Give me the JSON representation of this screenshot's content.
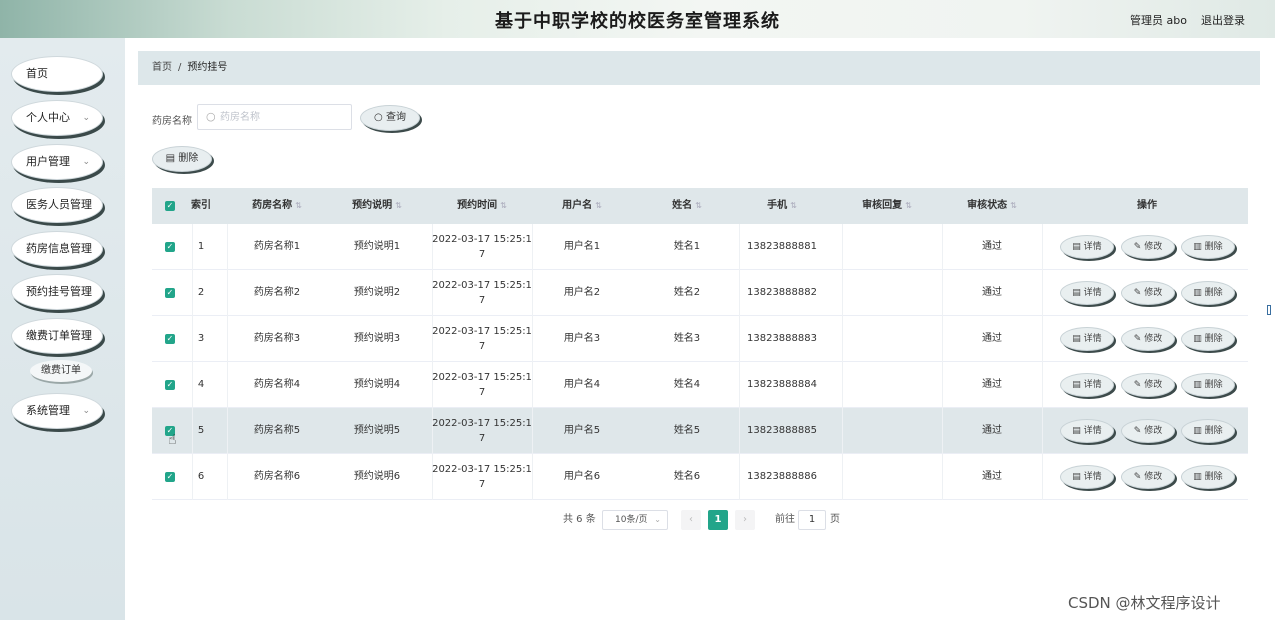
{
  "header": {
    "title": "基于中职学校的校医务室管理系统",
    "user": "管理员 abo",
    "logout": "退出登录"
  },
  "sidebar": {
    "items": [
      {
        "label": "首页",
        "chevron": ""
      },
      {
        "label": "个人中心",
        "chevron": "⌄"
      },
      {
        "label": "用户管理",
        "chevron": "⌄"
      },
      {
        "label": "医务人员管理",
        "chevron": ""
      },
      {
        "label": "药房信息管理",
        "chevron": ""
      },
      {
        "label": "预约挂号管理",
        "chevron": ""
      },
      {
        "label": "缴费订单管理",
        "chevron": ""
      },
      {
        "label": "系统管理",
        "chevron": "⌄"
      }
    ],
    "sub_item": "缴费订单"
  },
  "breadcrumb": {
    "home": "首页",
    "sep": "/",
    "current": "预约挂号"
  },
  "search": {
    "label": "药房名称",
    "placeholder": "药房名称",
    "value": "",
    "query_label": "查询",
    "delete_label": "删除"
  },
  "table": {
    "headers": {
      "index": "索引",
      "pharmacy": "药房名称",
      "desc": "预约说明",
      "time": "预约时间",
      "username": "用户名",
      "name": "姓名",
      "phone": "手机",
      "reply": "审核回复",
      "status": "审核状态",
      "ops": "操作"
    },
    "ops": {
      "detail": "详情",
      "edit": "修改",
      "delete": "删除"
    },
    "rows": [
      {
        "index": "1",
        "pharmacy": "药房名称1",
        "desc": "预约说明1",
        "time_a": "2022-03-17 15:25:1",
        "time_b": "7",
        "username": "用户名1",
        "name": "姓名1",
        "phone": "13823888881",
        "reply": "",
        "status": "通过"
      },
      {
        "index": "2",
        "pharmacy": "药房名称2",
        "desc": "预约说明2",
        "time_a": "2022-03-17 15:25:1",
        "time_b": "7",
        "username": "用户名2",
        "name": "姓名2",
        "phone": "13823888882",
        "reply": "",
        "status": "通过"
      },
      {
        "index": "3",
        "pharmacy": "药房名称3",
        "desc": "预约说明3",
        "time_a": "2022-03-17 15:25:1",
        "time_b": "7",
        "username": "用户名3",
        "name": "姓名3",
        "phone": "13823888883",
        "reply": "",
        "status": "通过"
      },
      {
        "index": "4",
        "pharmacy": "药房名称4",
        "desc": "预约说明4",
        "time_a": "2022-03-17 15:25:1",
        "time_b": "7",
        "username": "用户名4",
        "name": "姓名4",
        "phone": "13823888884",
        "reply": "",
        "status": "通过"
      },
      {
        "index": "5",
        "pharmacy": "药房名称5",
        "desc": "预约说明5",
        "time_a": "2022-03-17 15:25:1",
        "time_b": "7",
        "username": "用户名5",
        "name": "姓名5",
        "phone": "13823888885",
        "reply": "",
        "status": "通过"
      },
      {
        "index": "6",
        "pharmacy": "药房名称6",
        "desc": "预约说明6",
        "time_a": "2022-03-17 15:25:1",
        "time_b": "7",
        "username": "用户名6",
        "name": "姓名6",
        "phone": "13823888886",
        "reply": "",
        "status": "通过"
      }
    ]
  },
  "pagination": {
    "total": "共 6 条",
    "page_size": "10条/页",
    "prev": "‹",
    "current": "1",
    "next": "›",
    "goto": "前往",
    "goto_value": "1",
    "unit": "页"
  },
  "watermark": "CSDN @林文程序设计",
  "colors": {
    "accent": "#22a58a",
    "header_bg": "#dfe7ea"
  }
}
